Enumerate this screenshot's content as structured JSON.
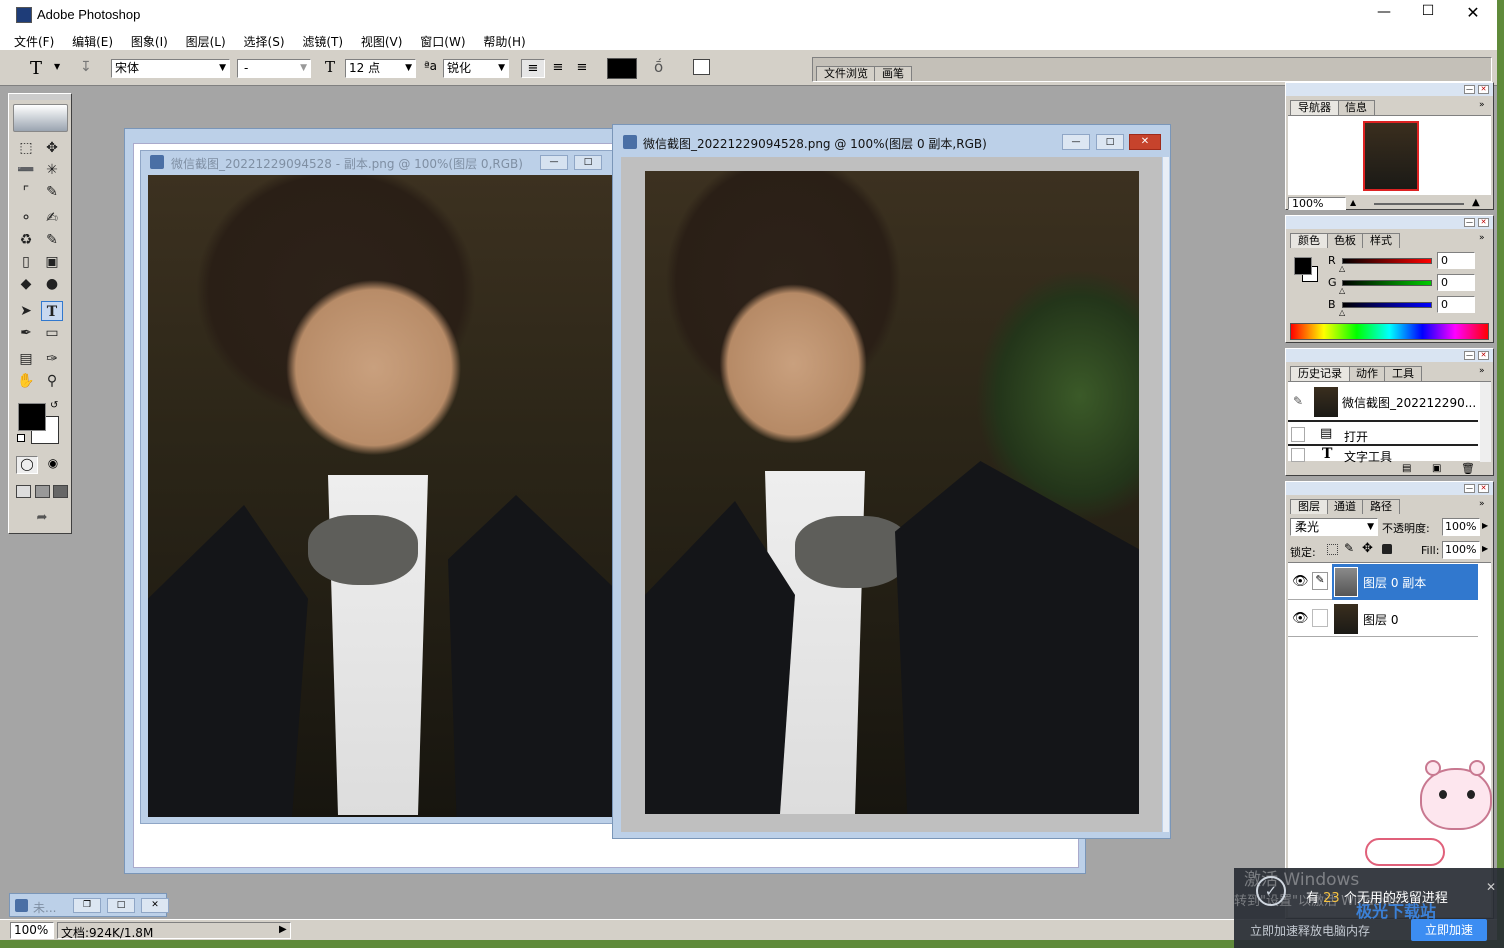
{
  "app": {
    "title": "Adobe Photoshop"
  },
  "menu": [
    "文件(F)",
    "编辑(E)",
    "图象(I)",
    "图层(L)",
    "选择(S)",
    "滤镜(T)",
    "视图(V)",
    "窗口(W)",
    "帮助(H)"
  ],
  "options": {
    "font_family": "宋体",
    "font_style": "-",
    "font_size": "12 点",
    "antialias": "锐化",
    "palette_well_tabs": [
      "文件浏览",
      "画笔"
    ]
  },
  "doc_back": {
    "title": "微信截图_20221229094528 - 副本.png @ 100%(图层 0,RGB)"
  },
  "doc_front": {
    "title": "微信截图_20221229094528.png @ 100%(图层 0 副本,RGB)"
  },
  "navigator": {
    "tabs": [
      "导航器",
      "信息"
    ],
    "zoom": "100%"
  },
  "color": {
    "tabs": [
      "颜色",
      "色板",
      "样式"
    ],
    "r_label": "R",
    "g_label": "G",
    "b_label": "B",
    "r": "0",
    "g": "0",
    "b": "0"
  },
  "history": {
    "tabs": [
      "历史记录",
      "动作",
      "工具"
    ],
    "snapshot": "微信截图_202212290...",
    "items": [
      "打开",
      "文字工具"
    ]
  },
  "layers": {
    "tabs": [
      "图层",
      "通道",
      "路径"
    ],
    "blend_mode": "柔光",
    "opacity_label": "不透明度:",
    "opacity": "100%",
    "lock_label": "锁定:",
    "fill_label": "Fill:",
    "fill": "100%",
    "items": [
      "图层 0 副本",
      "图层 0"
    ]
  },
  "minimized_doc": {
    "label": "未..."
  },
  "status": {
    "zoom": "100%",
    "doc": "文档:924K/1.8M"
  },
  "notification": {
    "watermark": "激活 Windows",
    "watermark2": "转到\"设置\"以激活 Windows",
    "message_pre": "有",
    "count": "23",
    "message_post": "个无用的残留进程",
    "sub": "立即加速释放电脑内存",
    "button": "立即加速",
    "brand": "极光下载站"
  },
  "colors": {
    "highlight": "#3178ce",
    "workspace": "#a5a5a5",
    "frame": "#bcd0e8"
  }
}
